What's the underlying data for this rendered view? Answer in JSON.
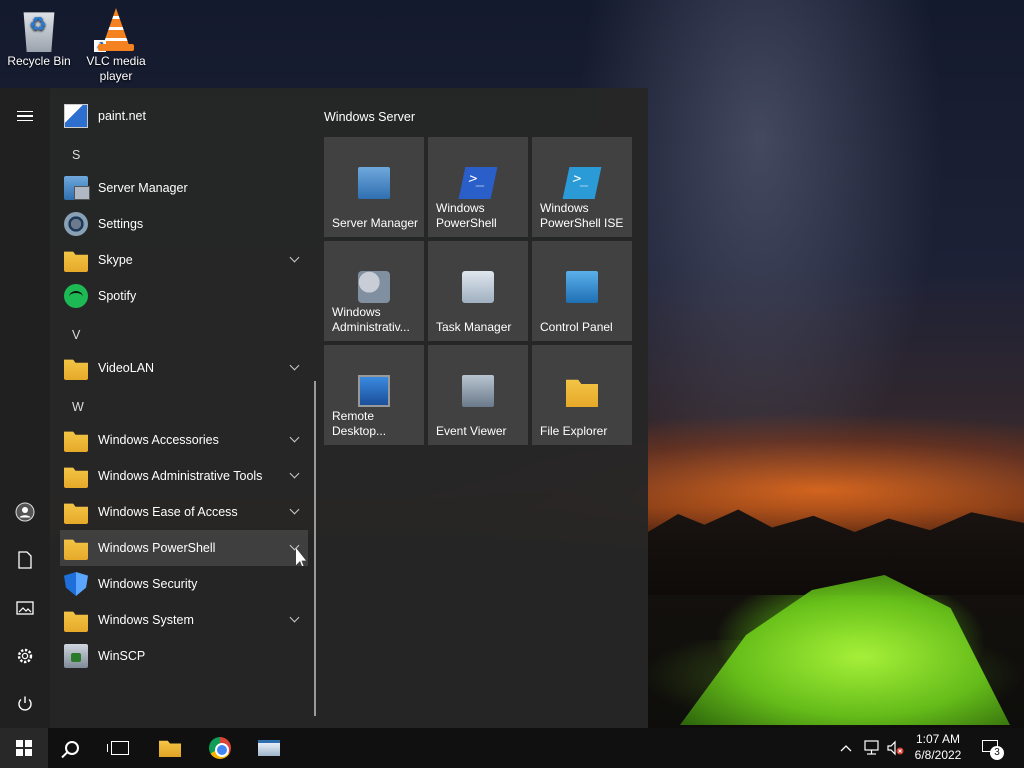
{
  "desktop": {
    "icons": [
      {
        "label": "Recycle Bin"
      },
      {
        "label": "VLC media player"
      }
    ]
  },
  "start_menu": {
    "apps": [
      {
        "label": "paint.net",
        "icon": "paintnet-icon",
        "expandable": false
      },
      {
        "letter": "S"
      },
      {
        "label": "Server Manager",
        "icon": "server-manager-icon",
        "expandable": false
      },
      {
        "label": "Settings",
        "icon": "gear-icon",
        "expandable": false
      },
      {
        "label": "Skype",
        "icon": "folder-icon",
        "expandable": true
      },
      {
        "label": "Spotify",
        "icon": "spotify-icon",
        "expandable": false
      },
      {
        "letter": "V"
      },
      {
        "label": "VideoLAN",
        "icon": "folder-icon",
        "expandable": true
      },
      {
        "letter": "W"
      },
      {
        "label": "Windows Accessories",
        "icon": "folder-icon",
        "expandable": true
      },
      {
        "label": "Windows Administrative Tools",
        "icon": "folder-icon",
        "expandable": true
      },
      {
        "label": "Windows Ease of Access",
        "icon": "folder-icon",
        "expandable": true
      },
      {
        "label": "Windows PowerShell",
        "icon": "folder-icon",
        "expandable": true,
        "hovered": true
      },
      {
        "label": "Windows Security",
        "icon": "shield-icon",
        "expandable": false
      },
      {
        "label": "Windows System",
        "icon": "folder-icon",
        "expandable": true
      },
      {
        "label": "WinSCP",
        "icon": "winscp-icon",
        "expandable": false
      }
    ],
    "tile_group_title": "Windows Server",
    "tiles": [
      {
        "label": "Server Manager",
        "icon": "server-manager-icon"
      },
      {
        "label": "Windows PowerShell",
        "icon": "powershell-icon"
      },
      {
        "label": "Windows PowerShell ISE",
        "icon": "powershell-ise-icon"
      },
      {
        "label": "Windows Administrativ...",
        "icon": "admin-tools-icon"
      },
      {
        "label": "Task Manager",
        "icon": "task-manager-icon"
      },
      {
        "label": "Control Panel",
        "icon": "control-panel-icon"
      },
      {
        "label": "Remote Desktop...",
        "icon": "remote-desktop-icon"
      },
      {
        "label": "Event Viewer",
        "icon": "event-viewer-icon"
      },
      {
        "label": "File Explorer",
        "icon": "folder-icon"
      }
    ],
    "rail": [
      "hamburger-icon",
      "user-icon",
      "document-icon",
      "pictures-icon",
      "gear-icon",
      "power-icon"
    ]
  },
  "taskbar": {
    "pinned": [
      "windows-logo-icon",
      "search-icon",
      "task-view-icon",
      "file-explorer-icon",
      "chrome-icon",
      "server-manager-icon"
    ],
    "clock": {
      "time": "1:07 AM",
      "date": "6/8/2022"
    },
    "notification_count": "3"
  },
  "colors": {
    "menu_bg": "#262626",
    "taskbar_bg": "#101010",
    "tile_bg": "#464646"
  }
}
